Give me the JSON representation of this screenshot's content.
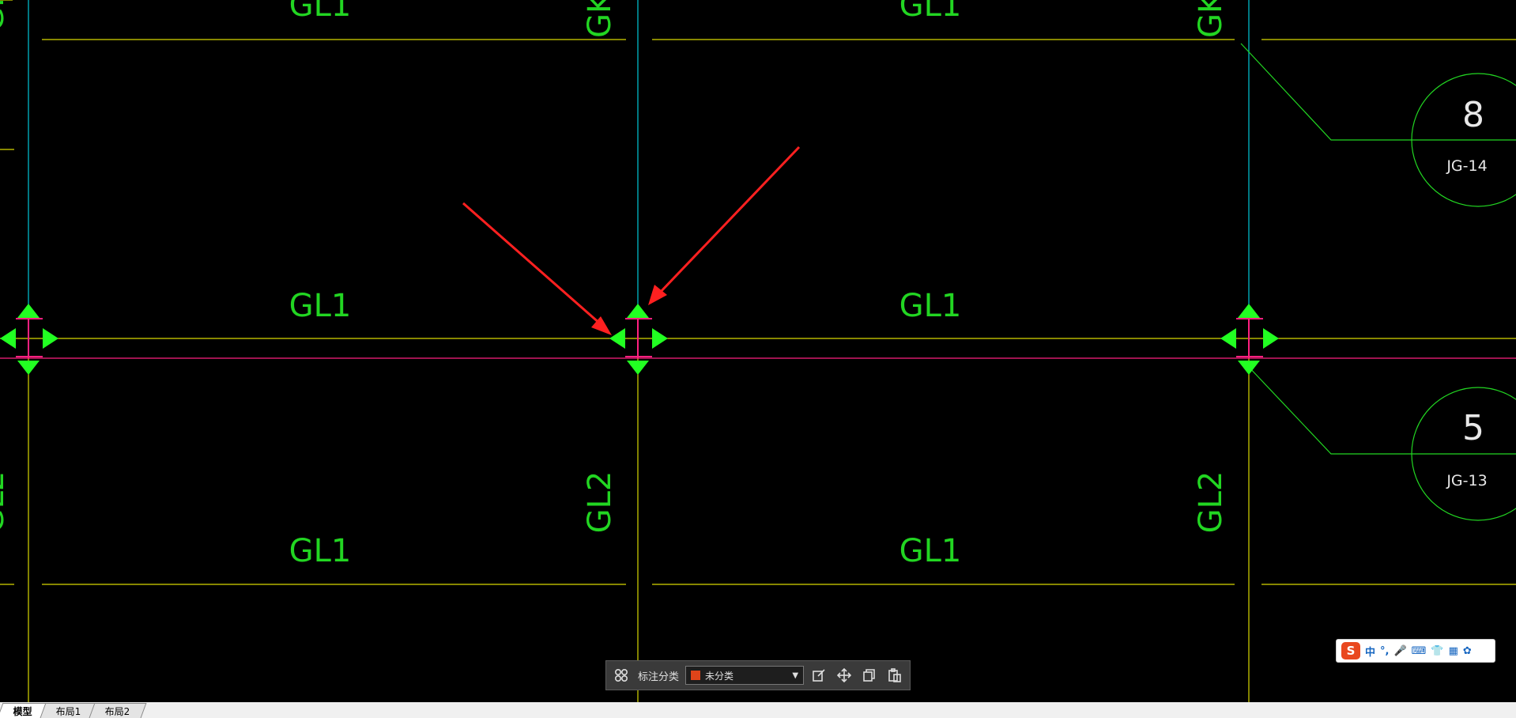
{
  "drawing": {
    "beam_labels": {
      "gl1": "GL1",
      "gl2": "GL2",
      "gk_partial": "GK"
    },
    "callouts": [
      {
        "number": "8",
        "code": "JG-14"
      },
      {
        "number": "5",
        "code": "JG-13"
      }
    ],
    "colors": {
      "background": "#000000",
      "beam_line": "#d8d800",
      "grid_line_cyan": "#00c8d8",
      "label_text": "#22d622",
      "grip": "#22ff22",
      "selection_line": "#ff2080",
      "arrow": "#ff2020",
      "callout_line": "#22d622"
    }
  },
  "annotation_toolbar": {
    "label": "标注分类",
    "selected_category": "未分类",
    "swatch_color": "#e0441a",
    "icons": [
      "grid-icon",
      "edit-icon",
      "move-icon",
      "copy-icon",
      "paste-icon"
    ]
  },
  "ime": {
    "logo": "S",
    "items": [
      "中",
      "°,",
      "🎤",
      "⌨",
      "👕",
      "▦",
      "✿"
    ]
  },
  "tabs": [
    {
      "label": "模型",
      "active": true
    },
    {
      "label": "布局1",
      "active": false
    },
    {
      "label": "布局2",
      "active": false
    }
  ]
}
